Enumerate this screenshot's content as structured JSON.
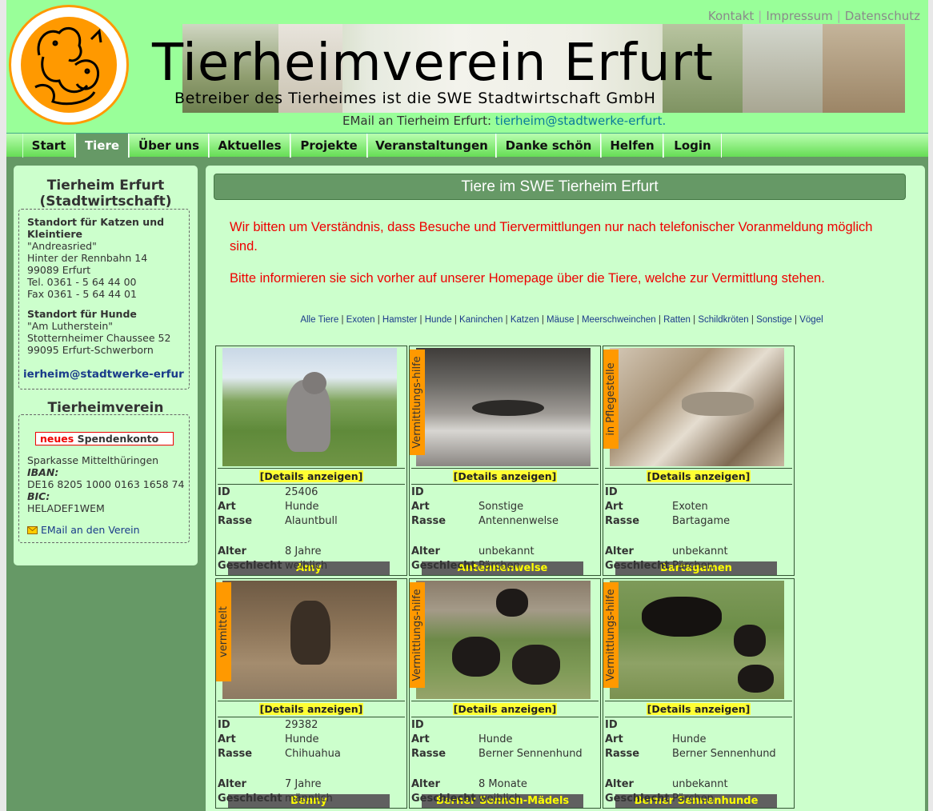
{
  "header": {
    "title": "Tierheimverein Erfurt",
    "subtitle": "Betreiber des Tierheimes ist die SWE Stadtwirtschaft GmbH",
    "email_label": "EMail an Tierheim Erfurt:",
    "email": "tierheim@stadtwerke-erfurt.",
    "top_links": [
      "Kontakt",
      "Impressum",
      "Datenschutz"
    ]
  },
  "nav": [
    "Start",
    "Tiere",
    "Über uns",
    "Aktuelles",
    "Projekte",
    "Veranstaltungen",
    "Danke schön",
    "Helfen",
    "Login"
  ],
  "sidebar": {
    "title": "Tierheim Erfurt (Stadtwirtschaft)",
    "site1_title": "Standort für Katzen und Kleintiere",
    "site1_name": "\"Andreasried\"",
    "site1_street": "Hinter der Rennbahn 14",
    "site1_city": "99089 Erfurt",
    "site1_tel": "Tel. 0361 - 5 64 44 00",
    "site1_fax": "Fax 0361 - 5 64 44 01",
    "site2_title": "Standort für Hunde",
    "site2_name": "\"Am Lutherstein\"",
    "site2_street": "Stotternheimer Chaussee 52",
    "site2_city": "99095 Erfurt-Schwerborn",
    "email": "ierheim@stadtwerke-erfur",
    "verein_title": "Tierheimverein",
    "spenden_new": "neues",
    "spenden_label": "Spendenkonto",
    "bank": "Sparkasse Mittelthüringen",
    "iban_label": "IBAN:",
    "iban": "DE16 8205 1000 0163 1658 74",
    "bic_label": "BIC:",
    "bic": "HELADEF1WEM",
    "verein_email": "EMail an den Verein"
  },
  "main": {
    "title": "Tiere im SWE Tierheim Erfurt",
    "notice1": "Wir bitten um Verständnis, dass Besuche und Tiervermittlungen nur nach telefonischer Voranmeldung möglich sind.",
    "notice2": "Bitte informieren sie sich vorher auf unserer Homepage über die Tiere, welche zur Vermittlung stehen.",
    "filters": [
      "Alle Tiere",
      "Exoten",
      "Hamster",
      "Hunde",
      "Kaninchen",
      "Katzen",
      "Mäuse",
      "Meerschweinchen",
      "Ratten",
      "Schildkröten",
      "Sonstige",
      "Vögel"
    ],
    "details_label": "[Details anzeigen]",
    "field_labels": {
      "id": "ID",
      "art": "Art",
      "rasse": "Rasse",
      "alter": "Alter",
      "geschlecht": "Geschlecht"
    }
  },
  "animals": [
    {
      "name": "Amy",
      "flag": "",
      "id": "25406",
      "art": "Hunde",
      "rasse": "Alauntbull",
      "alter": "8 Jahre",
      "geschlecht": "weiblich"
    },
    {
      "name": "Antennenwelse",
      "flag": "Vermittlungs-hilfe",
      "id": "",
      "art": "Sonstige",
      "rasse": "Antennenwelse",
      "alter": "unbekannt",
      "geschlecht": "Pärchen"
    },
    {
      "name": "Bartagamen",
      "flag": "in Pflegestelle",
      "id": "",
      "art": "Exoten",
      "rasse": "Bartagame",
      "alter": "unbekannt",
      "geschlecht": "Pärchen"
    },
    {
      "name": "Benny",
      "flag": "vermittelt",
      "id": "29382",
      "art": "Hunde",
      "rasse": "Chihuahua",
      "alter": "7 Jahre",
      "geschlecht": "männlich"
    },
    {
      "name": "Berner Sennen-Mädels",
      "flag": "Vermittlungs-hilfe",
      "id": "",
      "art": "Hunde",
      "rasse": "Berner Sennenhund",
      "alter": "8 Monate",
      "geschlecht": "weiblich"
    },
    {
      "name": "Berner Sennenhunde",
      "flag": "Vermittlungs-hilfe",
      "id": "",
      "art": "Hunde",
      "rasse": "Berner Sennenhund",
      "alter": "unbekannt",
      "geschlecht": "Pärchen"
    }
  ]
}
